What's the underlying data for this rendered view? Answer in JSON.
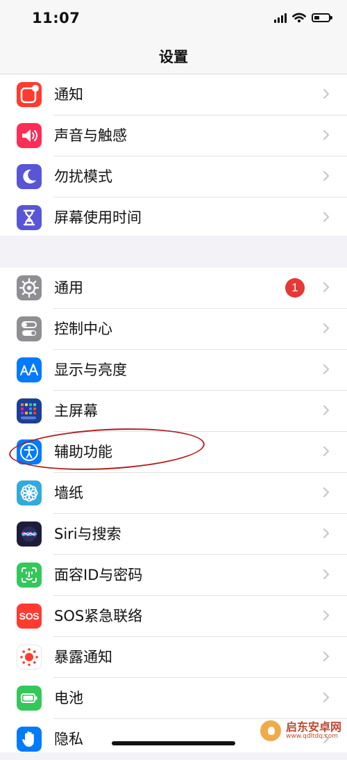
{
  "status_bar": {
    "time": "11:07",
    "battery_level": 0.35
  },
  "nav": {
    "title": "设置"
  },
  "groups": [
    {
      "items": [
        {
          "label": "通知",
          "icon": "notifications-icon",
          "color": "#ff3b30"
        },
        {
          "label": "声音与触感",
          "icon": "speaker-icon",
          "color": "#ff2d55"
        },
        {
          "label": "勿扰模式",
          "icon": "moon-icon",
          "color": "#5856d6"
        },
        {
          "label": "屏幕使用时间",
          "icon": "hourglass-icon",
          "color": "#5856d6"
        }
      ]
    },
    {
      "items": [
        {
          "label": "通用",
          "icon": "gear-icon",
          "color": "#8e8e93",
          "badge": "1"
        },
        {
          "label": "控制中心",
          "icon": "switches-icon",
          "color": "#8e8e93"
        },
        {
          "label": "显示与亮度",
          "icon": "text-size-icon",
          "color": "#007aff"
        },
        {
          "label": "主屏幕",
          "icon": "home-screen-grid-icon",
          "color": "#1c3f95"
        },
        {
          "label": "辅助功能",
          "icon": "accessibility-icon",
          "color": "#007aff"
        },
        {
          "label": "墙纸",
          "icon": "flower-icon",
          "color": "#34aadc"
        },
        {
          "label": "Siri与搜索",
          "icon": "siri-icon",
          "color": "#1d1d3a"
        },
        {
          "label": "面容ID与密码",
          "icon": "face-id-icon",
          "color": "#34c759"
        },
        {
          "label": "SOS紧急联络",
          "icon": "sos-icon",
          "color": "#ff3b30",
          "icon_text": "SOS"
        },
        {
          "label": "暴露通知",
          "icon": "exposure-notification-icon",
          "color": "#ffffff"
        },
        {
          "label": "电池",
          "icon": "battery-icon",
          "color": "#34c759"
        },
        {
          "label": "隐私",
          "icon": "hand-icon",
          "color": "#007aff"
        }
      ]
    }
  ],
  "highlight": {
    "target": "辅助功能",
    "color": "#b11f1f"
  },
  "watermark": {
    "title": "启东安卓网",
    "url": "www.qdltdq.com"
  }
}
